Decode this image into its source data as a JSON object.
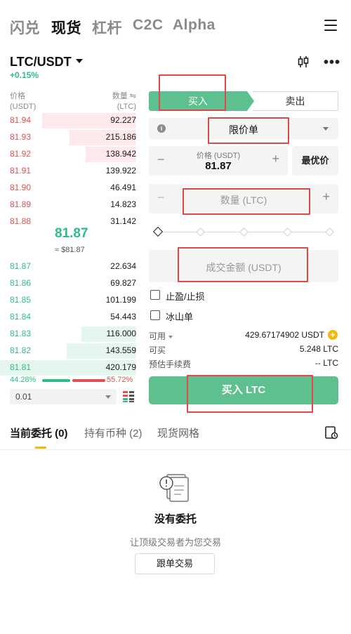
{
  "nav": {
    "tabs": [
      "闪兑",
      "现货",
      "杠杆",
      "C2C",
      "Alpha"
    ],
    "active": "现货"
  },
  "pair": {
    "symbol": "LTC/USDT",
    "change": "+0.15%"
  },
  "orderbook": {
    "price_header": "价格",
    "price_unit": "(USDT)",
    "qty_header": "数量 ⇋",
    "qty_unit": "(LTC)",
    "asks": [
      {
        "price": "81.94",
        "qty": "92.227",
        "depth": 0.69
      },
      {
        "price": "81.93",
        "qty": "215.186",
        "depth": 0.49
      },
      {
        "price": "81.92",
        "qty": "138.942",
        "depth": 0.37
      },
      {
        "price": "81.91",
        "qty": "139.922",
        "depth": 0.0
      },
      {
        "price": "81.90",
        "qty": "46.491",
        "depth": 0.0
      },
      {
        "price": "81.89",
        "qty": "14.823",
        "depth": 0.0
      },
      {
        "price": "81.88",
        "qty": "31.142",
        "depth": 0.0
      }
    ],
    "mid_price": "81.87",
    "mid_usd": "≈ $81.87",
    "bids": [
      {
        "price": "81.87",
        "qty": "22.634",
        "depth": 0.0
      },
      {
        "price": "81.86",
        "qty": "69.827",
        "depth": 0.0
      },
      {
        "price": "81.85",
        "qty": "101.199",
        "depth": 0.0
      },
      {
        "price": "81.84",
        "qty": "54.443",
        "depth": 0.0
      },
      {
        "price": "81.83",
        "qty": "116.000",
        "depth": 0.4
      },
      {
        "price": "81.82",
        "qty": "143.559",
        "depth": 0.51
      },
      {
        "price": "81.81",
        "qty": "420.179",
        "depth": 1.0
      }
    ],
    "buy_ratio": "44.28%",
    "sell_ratio": "55.72%",
    "buy_fraction": 0.4428,
    "precision": "0.01"
  },
  "form": {
    "buy_tab": "买入",
    "sell_tab": "卖出",
    "order_type": "限价单",
    "price_label": "价格 (USDT)",
    "price_value": "81.87",
    "best_price": "最优价",
    "qty_placeholder": "数量 (LTC)",
    "amount_placeholder": "成交金额 (USDT)",
    "tp_sl": "止盈/止损",
    "iceberg": "冰山单",
    "available_label": "可用",
    "available_value": "429.67174902 USDT",
    "buyable_label": "可买",
    "buyable_value": "5.248 LTC",
    "fee_label": "预估手续费",
    "fee_value": "-- LTC",
    "buy_button": "买入 LTC"
  },
  "bottom": {
    "tabs": [
      "当前委托 (0)",
      "持有币种 (2)",
      "现货网格"
    ],
    "empty_title": "没有委托",
    "empty_sub": "让顶级交易者为您交易",
    "copy_button": "跟单交易"
  },
  "colors": {
    "buy": "#2ebd85",
    "sell": "#e0514f",
    "highlight": "#e04848",
    "accent": "#f0b90b"
  }
}
